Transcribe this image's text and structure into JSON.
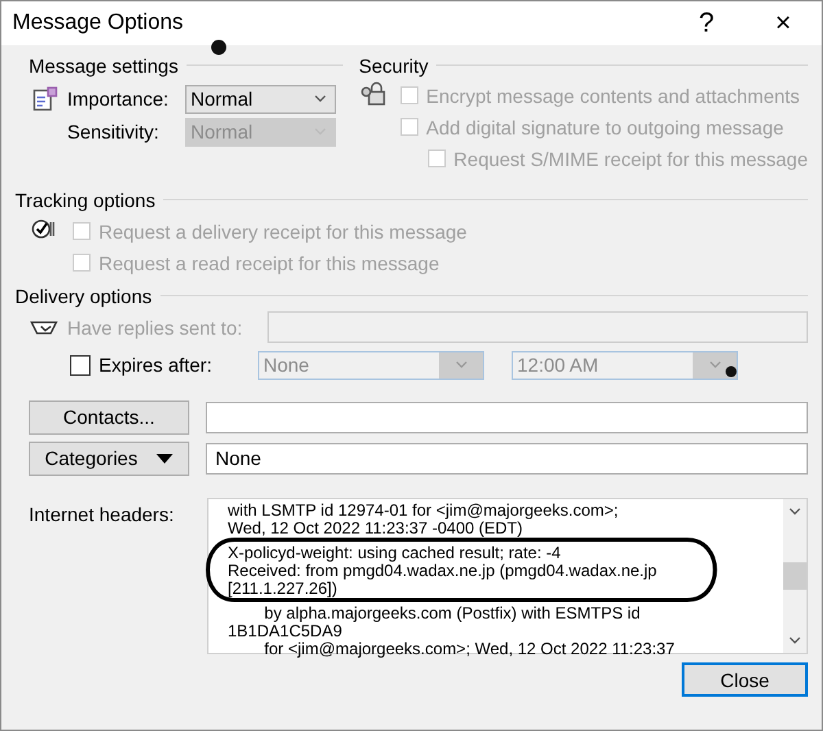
{
  "window": {
    "title": "Message Options",
    "help": "?",
    "close": "×"
  },
  "message_settings": {
    "title": "Message settings",
    "fields": [
      {
        "label": "Importance:",
        "value": "Normal",
        "disabled": false
      },
      {
        "label": "Sensitivity:",
        "value": "Normal",
        "disabled": true
      }
    ]
  },
  "security": {
    "title": "Security",
    "options": [
      {
        "label": "Encrypt message contents and attachments",
        "checked": false,
        "disabled": true
      },
      {
        "label": "Add digital signature to outgoing message",
        "checked": false,
        "disabled": true,
        "children": [
          {
            "label": "Request S/MIME receipt for this message",
            "checked": false,
            "disabled": true
          }
        ]
      }
    ]
  },
  "tracking": {
    "title": "Tracking options",
    "options": [
      {
        "label": "Request a delivery receipt for this message",
        "checked": false,
        "disabled": true
      },
      {
        "label": "Request a read receipt for this message",
        "checked": false,
        "disabled": true
      }
    ]
  },
  "delivery": {
    "title": "Delivery options",
    "replies": {
      "label": "Have replies sent to:",
      "disabled": true
    },
    "expires": {
      "label": "Expires after:",
      "checked": false,
      "date": "None",
      "time": "12:00 AM",
      "disabled": true
    },
    "contacts_button": "Contacts...",
    "categories_button": "Categories",
    "categories_value": "None"
  },
  "headers": {
    "label": "Internet headers:",
    "lines": [
      "with LSMTP id 12974-01 for <jim@majorgeeks.com>;",
      "Wed, 12 Oct 2022 11:23:37 -0400 (EDT)",
      "X-policyd-weight: using cached result; rate: -4",
      "Received: from pmgd04.wadax.ne.jp (pmgd04.wadax.ne.jp",
      "[211.1.227.26])",
      "        by alpha.majorgeeks.com (Postfix) with ESMTPS id",
      "1B1DA1C5DA9",
      "        for <jim@majorgeeks.com>; Wed, 12 Oct 2022 11:23:37"
    ]
  },
  "close_button": "Close"
}
